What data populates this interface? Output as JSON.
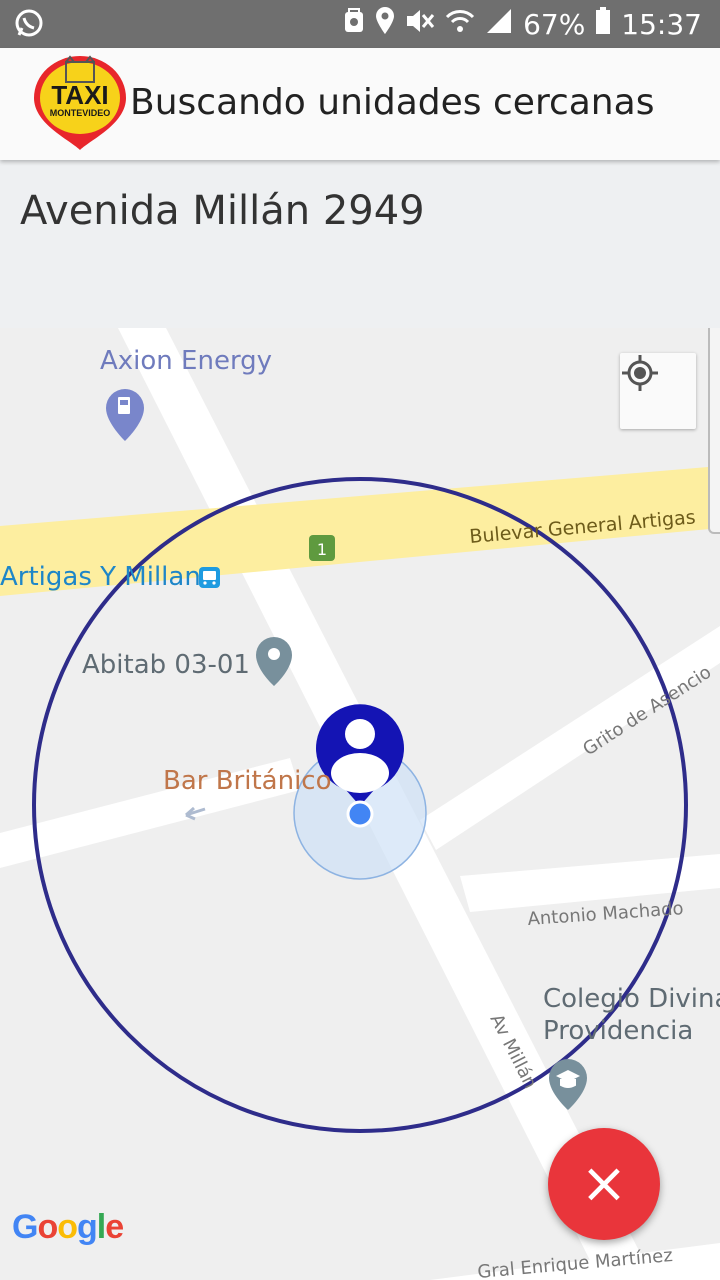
{
  "status_bar": {
    "battery": "67%",
    "time": "15:37"
  },
  "app_bar": {
    "logo_text": "TAXI",
    "logo_subtext": "MONTEVIDEO",
    "title": "Buscando unidades cercanas"
  },
  "address": {
    "text": "Avenida Millán 2949"
  },
  "map": {
    "labels": {
      "axion": "Axion Energy",
      "bulevar": "Bulevar General Artigas",
      "route_number": "1",
      "artigas_stop": "Artigas Y Millan",
      "abitab": "Abitab 03-01",
      "bar": "Bar Británico",
      "grito": "Grito de Asencio",
      "machado": "Antonio Machado",
      "colegio_line1": "Colegio Divina",
      "colegio_line2": "Providencia",
      "av_millan": "Av Millán",
      "gral": "Gral Enrique Martínez"
    },
    "attribution": "Google"
  },
  "fab": {
    "cancel_glyph": "×"
  },
  "colors": {
    "search_circle": "#2e2c8a",
    "user_pin": "#1414b4",
    "my_location": "#4285f4",
    "fab": "#e9353b",
    "highway": "#fdeea0"
  },
  "icons": [
    "whatsapp-icon",
    "gps-icon",
    "location-pin-icon",
    "mute-icon",
    "wifi-icon",
    "signal-icon",
    "battery-icon",
    "my-location-icon",
    "gas-station-icon",
    "bus-stop-icon",
    "pin-icon",
    "school-icon",
    "close-icon"
  ]
}
